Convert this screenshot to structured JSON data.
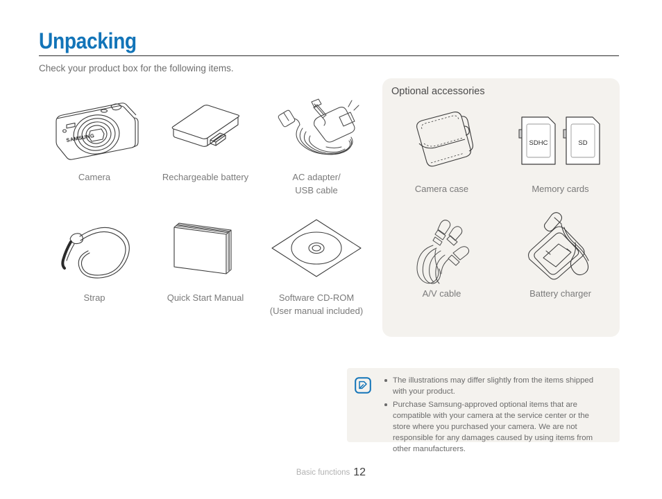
{
  "header": {
    "title": "Unpacking",
    "subtitle": "Check your product box for the following items."
  },
  "accent_color": "#1274b8",
  "panel_bg_color": "#f4f2ee",
  "included_items": [
    {
      "caption": "Camera",
      "icon": "camera-icon"
    },
    {
      "caption": "Rechargeable battery",
      "icon": "battery-icon"
    },
    {
      "caption": "AC adapter/\nUSB cable",
      "icon": "ac-adapter-usb-cable-icon"
    },
    {
      "caption": "Strap",
      "icon": "strap-icon"
    },
    {
      "caption": "Quick Start Manual",
      "icon": "manual-icon"
    },
    {
      "caption": "Software CD-ROM\n(User manual included)",
      "icon": "cd-rom-icon"
    }
  ],
  "optional": {
    "title": "Optional accessories",
    "items": [
      {
        "caption": "Camera case",
        "icon": "camera-case-icon"
      },
      {
        "caption": "Memory cards",
        "icon": "memory-cards-icon"
      },
      {
        "caption": "A/V cable",
        "icon": "av-cable-icon"
      },
      {
        "caption": "Battery charger",
        "icon": "battery-charger-icon"
      }
    ],
    "memory_card_labels": [
      "SDHC",
      "SD"
    ]
  },
  "note": {
    "icon": "note-pencil-icon",
    "bullets": [
      "The illustrations may differ slightly from the items shipped with your product.",
      "Purchase Samsung-approved optional items that are compatible with your camera at the service center or the store where you purchased your camera. We are not responsible for any damages caused by using items from other manufacturers."
    ]
  },
  "camera_brand": "SAMSUNG",
  "footer": {
    "section": "Basic functions",
    "page": "12"
  }
}
